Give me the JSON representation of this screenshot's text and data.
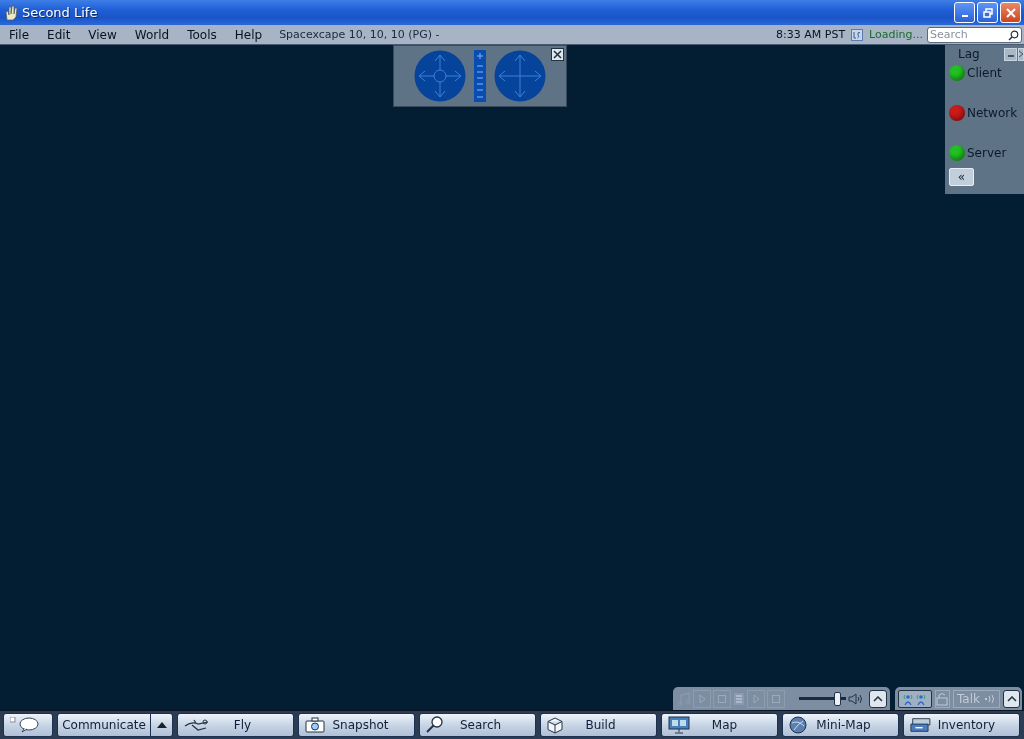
{
  "window": {
    "title": "Second Life"
  },
  "menu": [
    "File",
    "Edit",
    "View",
    "World",
    "Tools",
    "Help"
  ],
  "location": "Spacexcape 10, 10, 10 (PG) -",
  "clock": "8:33 AM PST",
  "balance_status": "Loading...",
  "search": {
    "placeholder": "Search"
  },
  "lag_meter": {
    "title": "Lag",
    "collapse": "«",
    "indicators": [
      {
        "label": "Client",
        "color": "#22c022"
      },
      {
        "label": "Network",
        "color": "#cc1a1a"
      },
      {
        "label": "Server",
        "color": "#22c022"
      }
    ]
  },
  "media": {
    "volume": {
      "level": 0.88
    }
  },
  "voice": {
    "talk": {
      "label": "Talk",
      "disabled": true
    }
  },
  "toolbar": [
    {
      "kind": "chat"
    },
    {
      "kind": "communicate",
      "label": "Communicate"
    },
    {
      "kind": "fly",
      "label": "Fly"
    },
    {
      "kind": "snapshot",
      "label": "Snapshot"
    },
    {
      "kind": "search",
      "label": "Search"
    },
    {
      "kind": "build",
      "label": "Build"
    },
    {
      "kind": "map",
      "label": "Map"
    },
    {
      "kind": "minimap",
      "label": "Mini-Map"
    },
    {
      "kind": "inventory",
      "label": "Inventory"
    }
  ]
}
